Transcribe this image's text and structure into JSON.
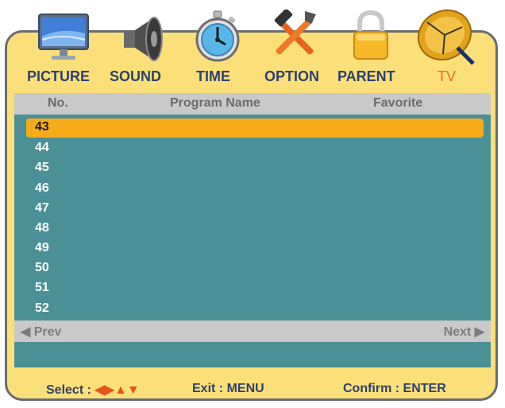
{
  "tabs": [
    {
      "label": "PICTURE",
      "icon": "monitor-icon"
    },
    {
      "label": "SOUND",
      "icon": "speaker-icon"
    },
    {
      "label": "TIME",
      "icon": "stopwatch-icon"
    },
    {
      "label": "OPTION",
      "icon": "tools-icon"
    },
    {
      "label": "PARENT",
      "icon": "padlock-icon"
    },
    {
      "label": "TV",
      "icon": "satellite-dish-icon",
      "active": true
    }
  ],
  "table": {
    "columns": [
      "No.",
      "Program Name",
      "Favorite"
    ],
    "rows": [
      "43",
      "44",
      "45",
      "46",
      "47",
      "48",
      "49",
      "50",
      "51",
      "52"
    ],
    "selected_index": 0
  },
  "nav": {
    "prev": "◀ Prev",
    "next": "Next ▶"
  },
  "footer": {
    "select_label": "Select :",
    "select_arrows": "◀▶▲▼",
    "exit": "Exit : MENU",
    "confirm": "Confirm : ENTER"
  },
  "colors": {
    "frame": "#fbe07a",
    "panel": "#4a9096",
    "header": "#c9c9c9",
    "selection": "#f5ac18",
    "tab_text": "#2f3f6b",
    "active_tab": "#e86a2a"
  }
}
